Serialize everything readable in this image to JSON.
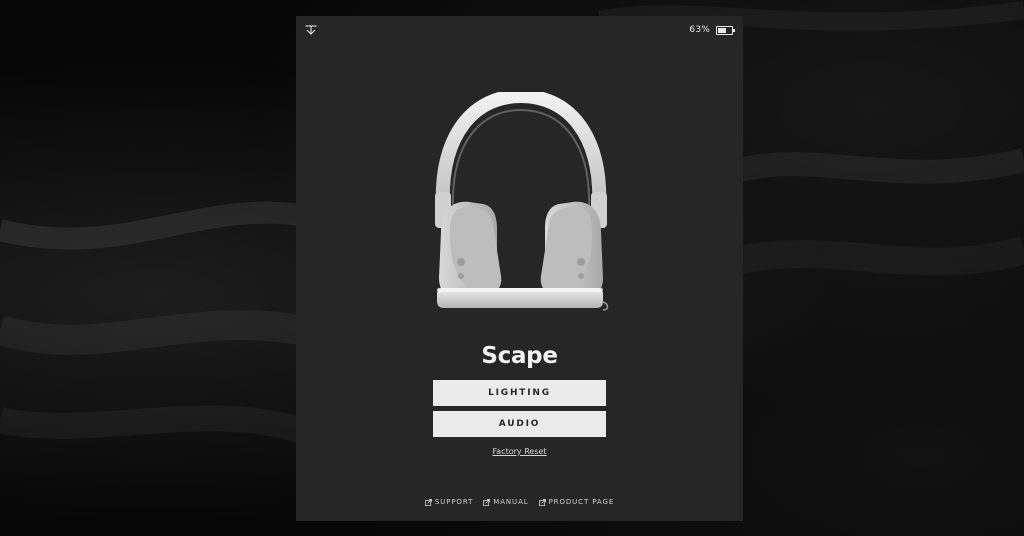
{
  "battery": {
    "percent_label": "63%",
    "level": 0.63
  },
  "device": {
    "name": "Scape",
    "image_icon": "headphones-on-stand-image"
  },
  "menu": {
    "lighting_label": "LIGHTING",
    "audio_label": "AUDIO",
    "factory_reset_label": "Factory Reset"
  },
  "footer": {
    "links": [
      {
        "label": "SUPPORT",
        "icon": "external-link-icon"
      },
      {
        "label": "MANUAL",
        "icon": "external-link-icon"
      },
      {
        "label": "PRODUCT PAGE",
        "icon": "external-link-icon"
      }
    ]
  },
  "colors": {
    "panel_bg": "#262626",
    "button_bg": "#ebebeb",
    "page_bg": "#070707"
  }
}
